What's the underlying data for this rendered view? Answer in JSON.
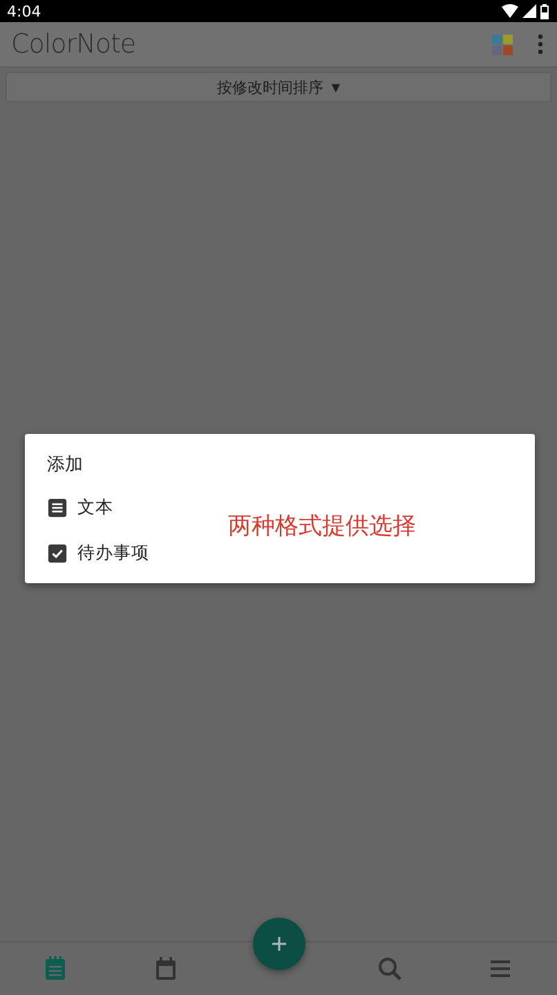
{
  "status_bar": {
    "time": "4:04"
  },
  "app_bar": {
    "title": "ColorNote"
  },
  "sort_bar": {
    "label": "按修改时间排序",
    "caret": "▼"
  },
  "dialog": {
    "title": "添加",
    "options": [
      {
        "kind": "text",
        "label": "文本"
      },
      {
        "kind": "checklist",
        "label": "待办事项"
      }
    ]
  },
  "annotation": "两种格式提供选择",
  "bottom_nav": [
    {
      "kind": "notes",
      "selected": true
    },
    {
      "kind": "calendar",
      "selected": false
    },
    {
      "kind": "search",
      "selected": false
    },
    {
      "kind": "menu",
      "selected": false
    }
  ]
}
